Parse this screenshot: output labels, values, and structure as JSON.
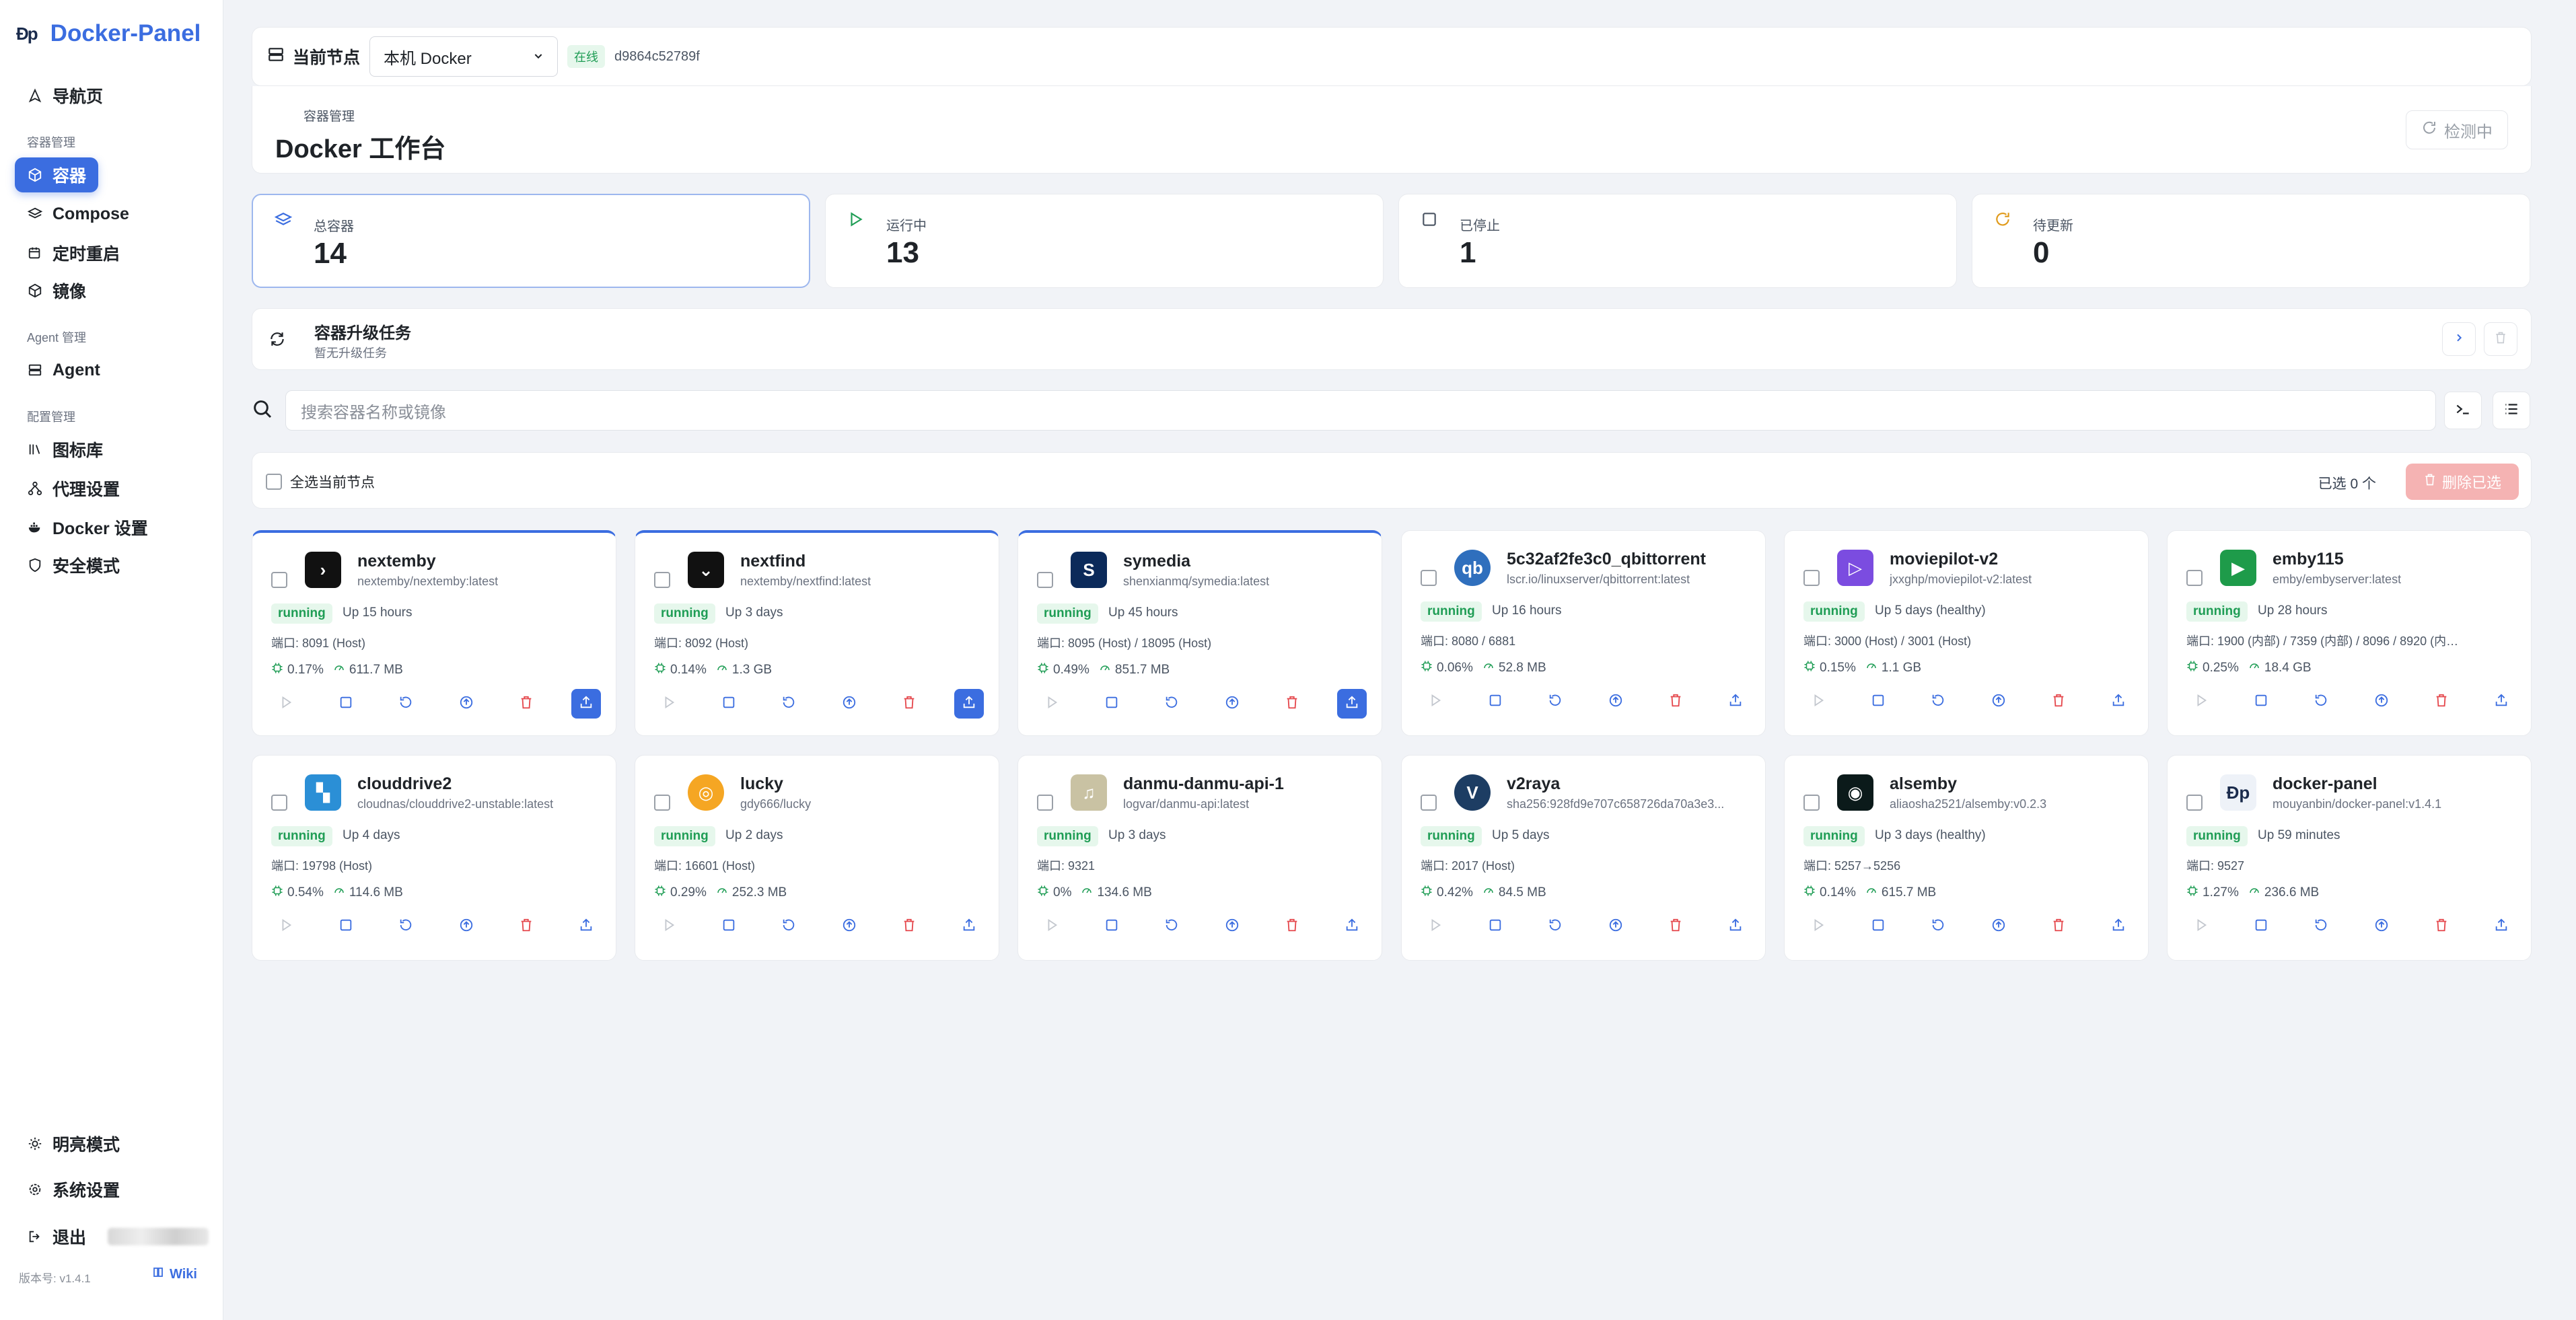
{
  "sidebar": {
    "logo_text": "Ɖp",
    "brand": "Docker-Panel",
    "nav_home": "导航页",
    "section_container": "容器管理",
    "nav_containers": "容器",
    "nav_compose": "Compose",
    "nav_schedule": "定时重启",
    "nav_images": "镜像",
    "section_agent": "Agent 管理",
    "nav_agent": "Agent",
    "section_config": "配置管理",
    "nav_icons": "图标库",
    "nav_proxy": "代理设置",
    "nav_docker": "Docker 设置",
    "nav_security": "安全模式",
    "nav_light": "明亮模式",
    "nav_settings": "系统设置",
    "nav_logout": "退出",
    "version": "版本号: v1.4.1",
    "wiki": "Wiki"
  },
  "topbar": {
    "label": "当前节点",
    "node_select": "本机 Docker",
    "online": "在线",
    "node_id": "d9864c52789f"
  },
  "header": {
    "crumb": "容器管理",
    "title": "Docker 工作台",
    "detect": "检测中"
  },
  "stats": [
    {
      "label": "总容器",
      "value": "14"
    },
    {
      "label": "运行中",
      "value": "13"
    },
    {
      "label": "已停止",
      "value": "1"
    },
    {
      "label": "待更新",
      "value": "0"
    }
  ],
  "upgrade": {
    "title": "容器升级任务",
    "subtitle": "暂无升级任务"
  },
  "search": {
    "placeholder": "搜索容器名称或镜像"
  },
  "selection": {
    "select_all": "全选当前节点",
    "selected_count": "已选 0 个",
    "delete_selected": "删除已选"
  },
  "containers": [
    {
      "name": "nextemby",
      "image": "nextemby/nextemby:latest",
      "status": "running",
      "uptime": "Up 15 hours",
      "ports": "端口: 8091 (Host)",
      "cpu": "0.17%",
      "mem": "611.7 MB"
    },
    {
      "name": "nextfind",
      "image": "nextemby/nextfind:latest",
      "status": "running",
      "uptime": "Up 3 days",
      "ports": "端口: 8092 (Host)",
      "cpu": "0.14%",
      "mem": "1.3 GB"
    },
    {
      "name": "symedia",
      "image": "shenxianmq/symedia:latest",
      "status": "running",
      "uptime": "Up 45 hours",
      "ports": "端口: 8095 (Host) / 18095 (Host)",
      "cpu": "0.49%",
      "mem": "851.7 MB"
    },
    {
      "name": "5c32af2fe3c0_qbittorrent",
      "image": "lscr.io/linuxserver/qbittorrent:latest",
      "status": "running",
      "uptime": "Up 16 hours",
      "ports": "端口: 8080 / 6881",
      "cpu": "0.06%",
      "mem": "52.8 MB"
    },
    {
      "name": "moviepilot-v2",
      "image": "jxxghp/moviepilot-v2:latest",
      "status": "running",
      "uptime": "Up 5 days (healthy)",
      "ports": "端口: 3000 (Host) / 3001 (Host)",
      "cpu": "0.15%",
      "mem": "1.1 GB"
    },
    {
      "name": "emby115",
      "image": "emby/embyserver:latest",
      "status": "running",
      "uptime": "Up 28 hours",
      "ports": "端口: 1900 (内部) / 7359 (内部) / 8096 / 8920 (内…",
      "cpu": "0.25%",
      "mem": "18.4 GB"
    },
    {
      "name": "clouddrive2",
      "image": "cloudnas/clouddrive2-unstable:latest",
      "status": "running",
      "uptime": "Up 4 days",
      "ports": "端口: 19798 (Host)",
      "cpu": "0.54%",
      "mem": "114.6 MB"
    },
    {
      "name": "lucky",
      "image": "gdy666/lucky",
      "status": "running",
      "uptime": "Up 2 days",
      "ports": "端口: 16601 (Host)",
      "cpu": "0.29%",
      "mem": "252.3 MB"
    },
    {
      "name": "danmu-danmu-api-1",
      "image": "logvar/danmu-api:latest",
      "status": "running",
      "uptime": "Up 3 days",
      "ports": "端口: 9321",
      "cpu": "0%",
      "mem": "134.6 MB"
    },
    {
      "name": "v2raya",
      "image": "sha256:928fd9e707c658726da70a3e3...",
      "status": "running",
      "uptime": "Up 5 days",
      "ports": "端口: 2017 (Host)",
      "cpu": "0.42%",
      "mem": "84.5 MB"
    },
    {
      "name": "alsemby",
      "image": "aliaosha2521/alsemby:v0.2.3",
      "status": "running",
      "uptime": "Up 3 days (healthy)",
      "ports": "端口: 5257→5256",
      "cpu": "0.14%",
      "mem": "615.7 MB"
    },
    {
      "name": "docker-panel",
      "image": "mouyanbin/docker-panel:v1.4.1",
      "status": "running",
      "uptime": "Up 59 minutes",
      "ports": "端口: 9527",
      "cpu": "1.27%",
      "mem": "236.6 MB"
    }
  ],
  "colors": {
    "accent": "#3b6de0",
    "running_bg": "#e6f7ec",
    "running_fg": "#1f9d55",
    "danger": "#e5484d"
  }
}
